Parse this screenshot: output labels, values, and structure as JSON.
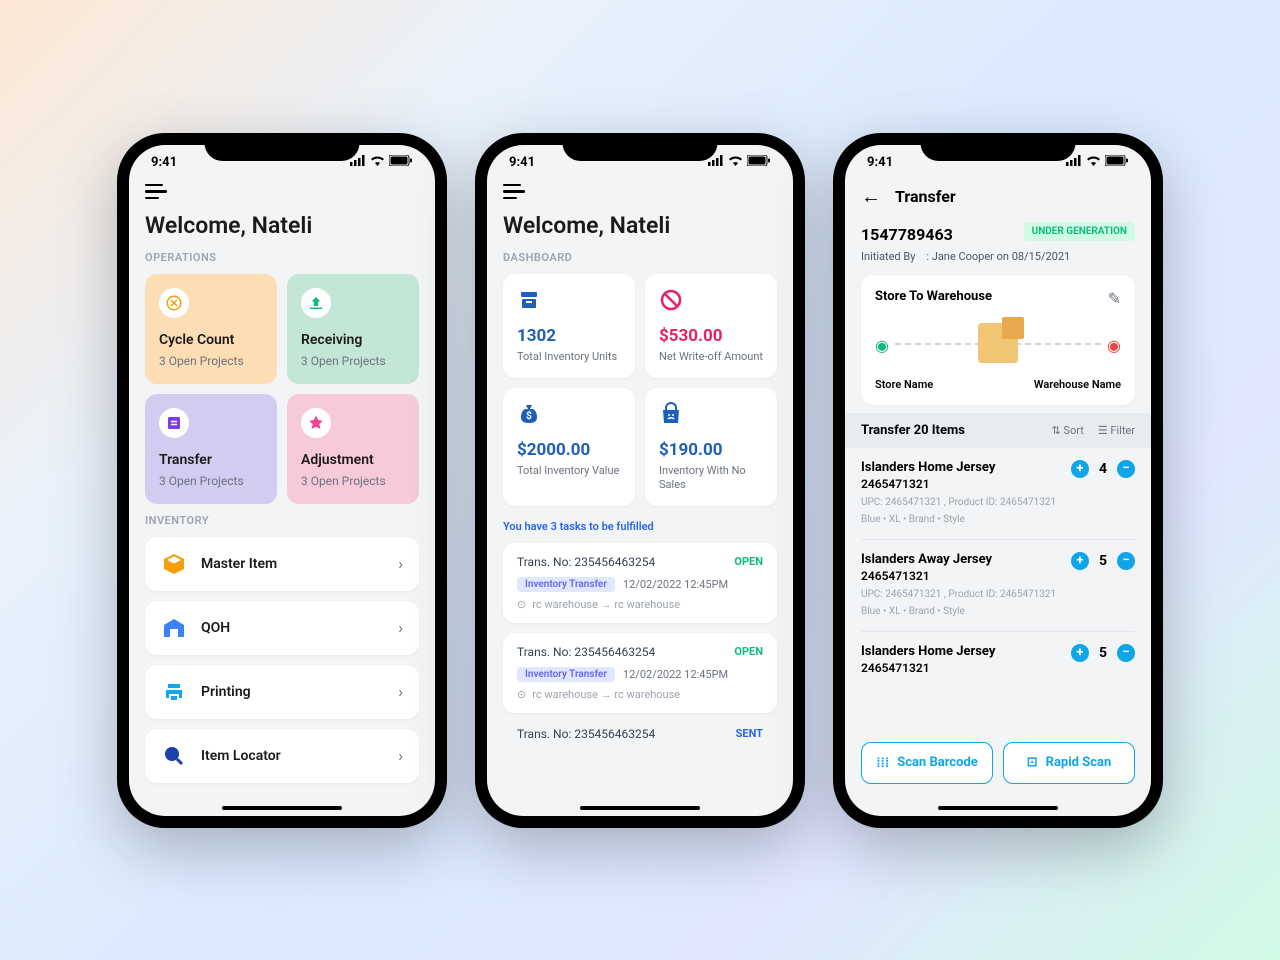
{
  "statusbar": {
    "time": "9:41"
  },
  "phone1": {
    "welcome": "Welcome, Nateli",
    "sections": {
      "operations": "OPERATIONS",
      "inventory": "INVENTORY"
    },
    "ops": [
      {
        "title": "Cycle Count",
        "sub": "3 Open Projects"
      },
      {
        "title": "Receiving",
        "sub": "3 Open Projects"
      },
      {
        "title": "Transfer",
        "sub": "3 Open Projects"
      },
      {
        "title": "Adjustment",
        "sub": "3 Open Projects"
      }
    ],
    "inv": [
      {
        "label": "Master Item"
      },
      {
        "label": "QOH"
      },
      {
        "label": "Printing"
      },
      {
        "label": "Item Locator"
      }
    ]
  },
  "phone2": {
    "welcome": "Welcome, Nateli",
    "section": "DASHBOARD",
    "cards": [
      {
        "val": "1302",
        "label": "Total Inventory Units",
        "color": "blue"
      },
      {
        "val": "$530.00",
        "label": "Net Write-off Amount",
        "color": "red"
      },
      {
        "val": "$2000.00",
        "label": "Total Inventory Value",
        "color": "blue"
      },
      {
        "val": "$190.00",
        "label": "Inventory With No Sales",
        "color": "blue"
      }
    ],
    "tasks_note": "You have 3 tasks to be fulfilled",
    "tasks": [
      {
        "no": "Trans. No: 235456463254",
        "status": "OPEN",
        "tag": "Inventory Transfer",
        "dt": "12/02/2022 12:45PM",
        "route": "rc warehouse → rc warehouse"
      },
      {
        "no": "Trans. No: 235456463254",
        "status": "OPEN",
        "tag": "Inventory Transfer",
        "dt": "12/02/2022 12:45PM",
        "route": "rc warehouse → rc warehouse"
      },
      {
        "no": "Trans. No: 235456463254",
        "status": "SENT"
      }
    ]
  },
  "phone3": {
    "title": "Transfer",
    "id": "1547789463",
    "status": "UNDER GENERATION",
    "meta_label": "Initiated By",
    "meta_sep": ":",
    "meta_value": "Jane Cooper on 08/15/2021",
    "route": {
      "title": "Store To Warehouse",
      "from": "Store Name",
      "to": "Warehouse Name"
    },
    "section": "Transfer 20 Items",
    "sort": "Sort",
    "filter": "Filter",
    "items": [
      {
        "name": "Islanders Home Jersey",
        "sku": "2465471321",
        "qty": "4",
        "meta": "UPC: 2465471321 , Product ID: 2465471321",
        "attrs": "Blue • XL   • Brand   • Style"
      },
      {
        "name": "Islanders Away Jersey",
        "sku": "2465471321",
        "qty": "5",
        "meta": "UPC: 2465471321 , Product ID: 2465471321",
        "attrs": "Blue • XL   • Brand   • Style"
      },
      {
        "name": "Islanders Home Jersey",
        "sku": "2465471321",
        "qty": "5"
      }
    ],
    "scan1": "Scan Barcode",
    "scan2": "Rapid Scan"
  }
}
